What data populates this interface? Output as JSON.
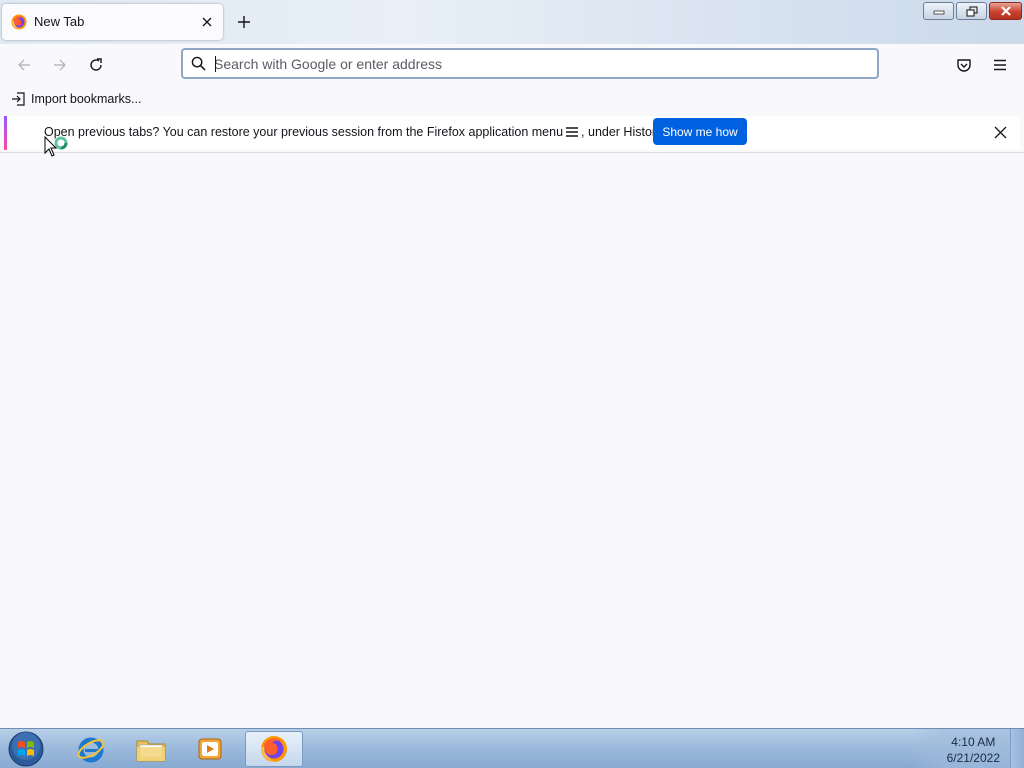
{
  "window": {
    "controls": [
      "minimize",
      "restore",
      "close"
    ]
  },
  "tabs": [
    {
      "title": "New Tab",
      "icon": "firefox-icon",
      "active": true
    }
  ],
  "toolbar": {
    "back_icon": "back-arrow-icon",
    "forward_icon": "forward-arrow-icon",
    "reload_icon": "reload-icon",
    "pocket_icon": "pocket-icon",
    "menu_icon": "hamburger-menu-icon"
  },
  "urlbar": {
    "placeholder": "Search with Google or enter address",
    "value": ""
  },
  "bookmarks": {
    "import_label": "Import bookmarks..."
  },
  "notification": {
    "text_before": "Open previous tabs? You can restore your previous session from the Firefox application menu",
    "text_after": ", under History.",
    "action_label": "Show me how",
    "accent_colors": [
      "#9059ff",
      "#ff4aa2"
    ],
    "action_color": "#0061e0"
  },
  "taskbar": {
    "apps": [
      {
        "name": "Internet Explorer",
        "icon": "internet-explorer-icon",
        "active": false
      },
      {
        "name": "Windows Explorer",
        "icon": "folder-icon",
        "active": false
      },
      {
        "name": "Windows Media Player",
        "icon": "media-player-icon",
        "active": false
      },
      {
        "name": "Firefox",
        "icon": "firefox-icon",
        "active": true
      }
    ],
    "clock": {
      "time": "4:10 AM",
      "date": "6/21/2022"
    }
  }
}
